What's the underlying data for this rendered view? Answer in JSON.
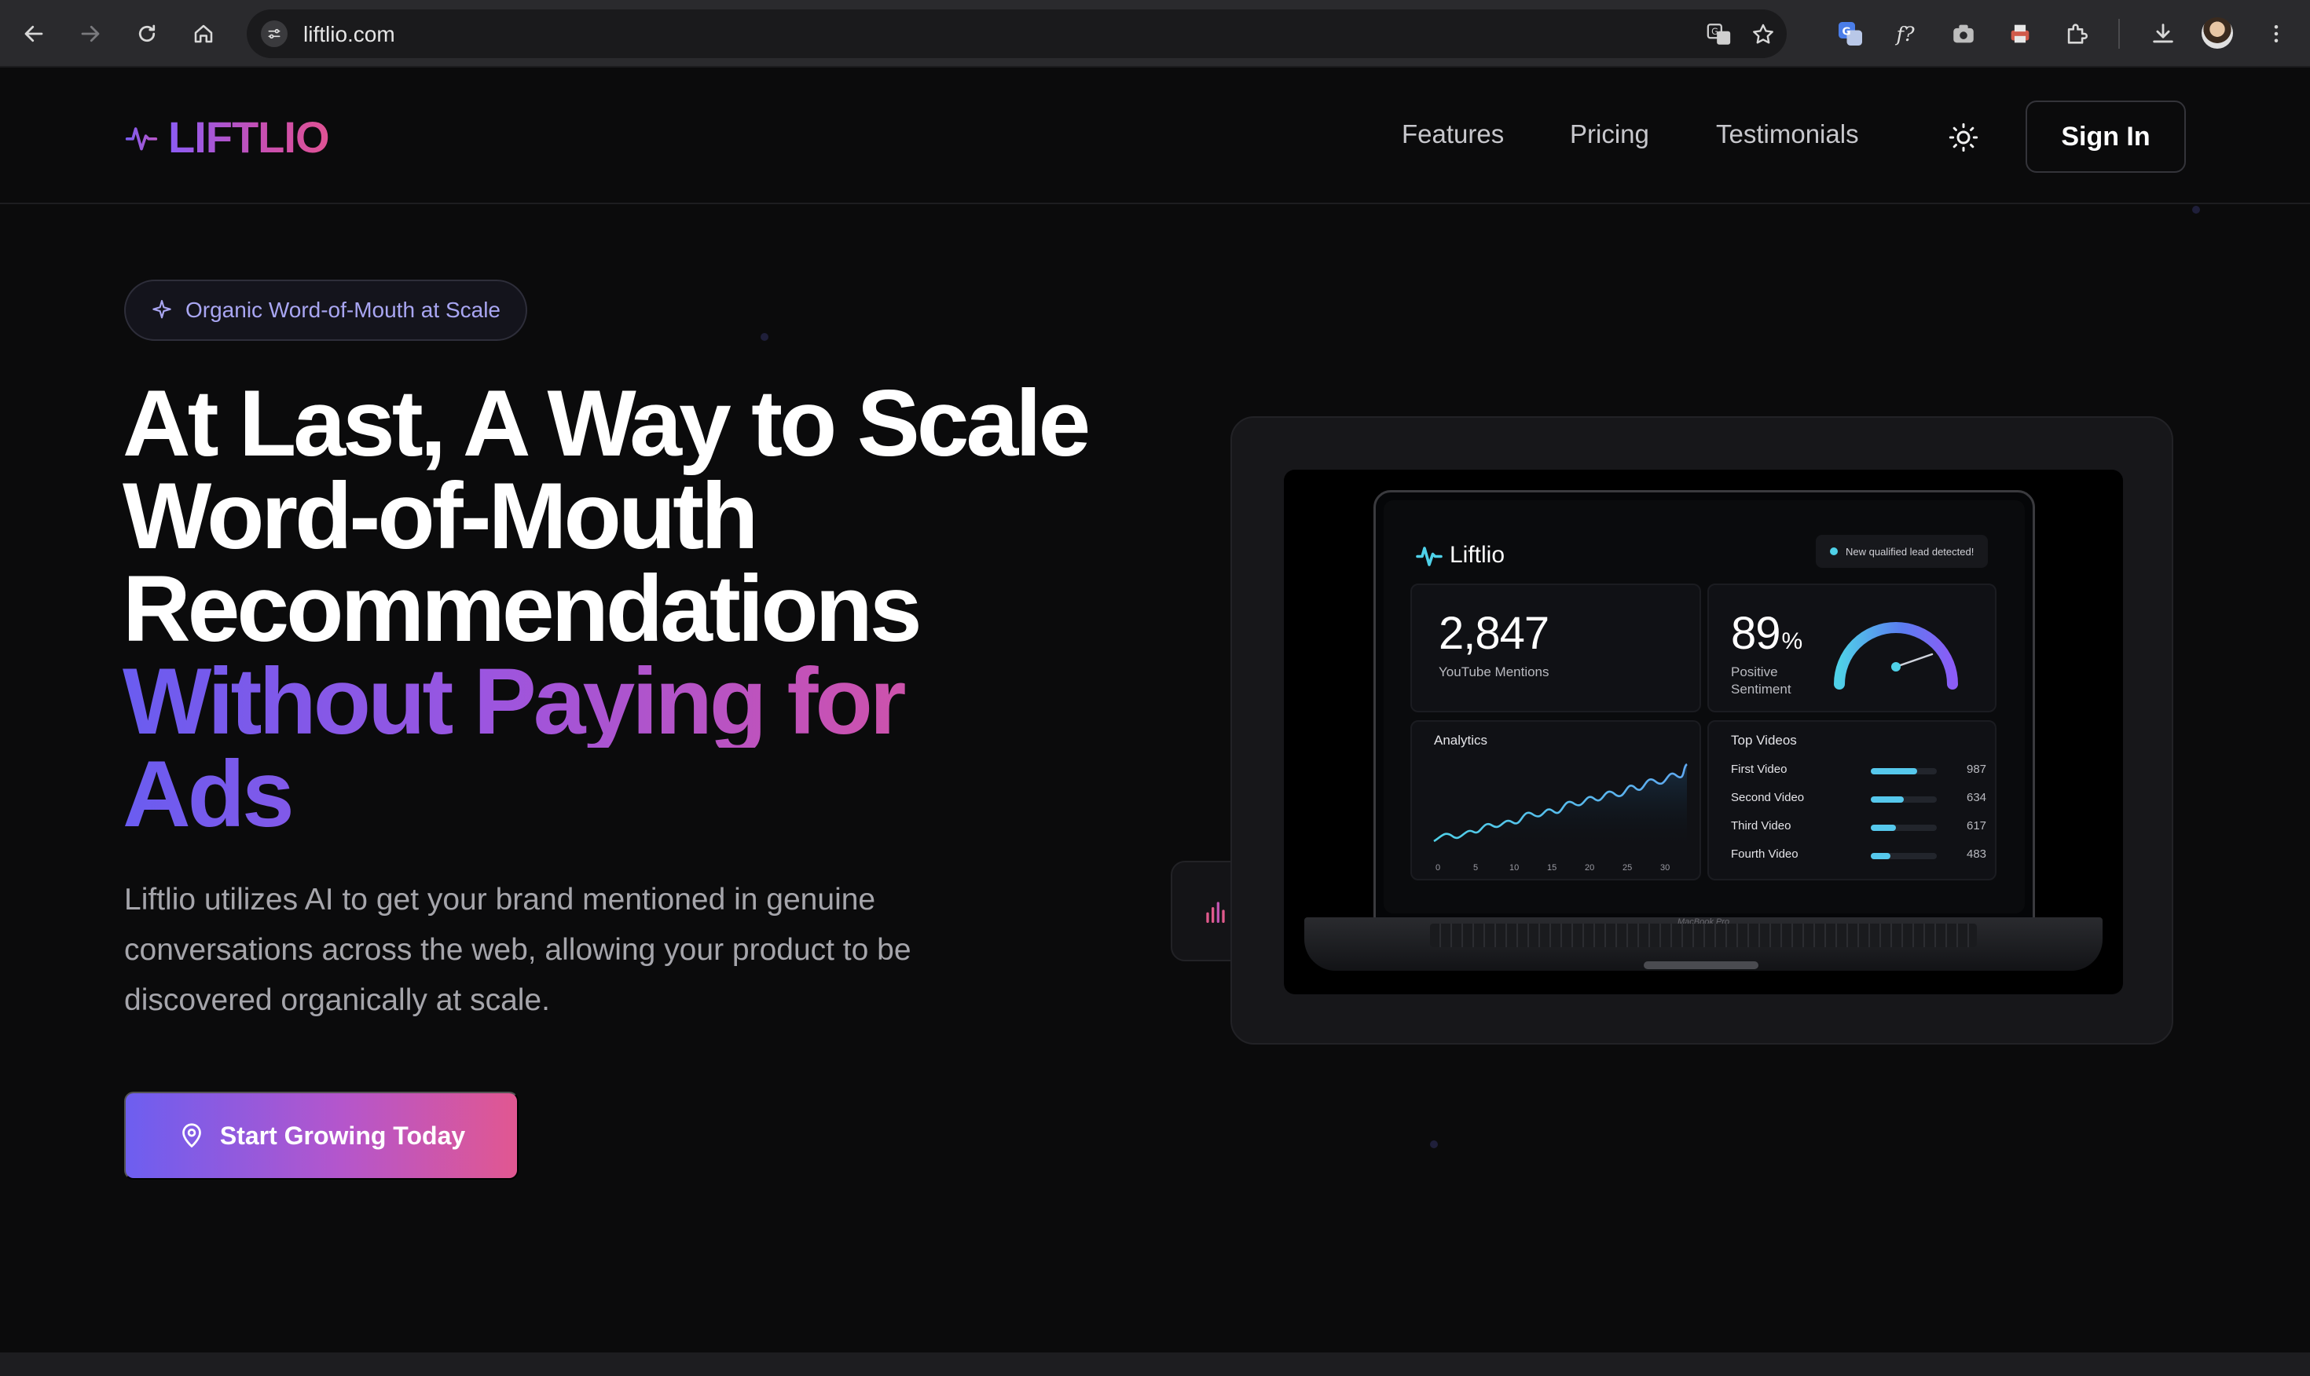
{
  "browser": {
    "url": "liftlio.com",
    "icons": [
      "back-icon",
      "forward-icon",
      "reload-icon",
      "home-icon",
      "site-info-icon",
      "translate-icon",
      "bookmark-star-icon",
      "extension-translate-icon",
      "extension-font-icon",
      "extension-camera-icon",
      "extension-printer-icon",
      "extensions-puzzle-icon",
      "download-icon",
      "profile-avatar",
      "menu-kebab-icon"
    ]
  },
  "header": {
    "logo_text": "LIFTLIO",
    "nav": [
      "Features",
      "Pricing",
      "Testimonials"
    ],
    "theme_icon": "sun-icon",
    "sign_in": "Sign In"
  },
  "hero": {
    "badge": "Organic Word-of-Mouth at Scale",
    "headline_lines": [
      "At Last, A Way to Scale",
      "Word-of-Mouth",
      "Recommendations"
    ],
    "headline_gradient_lines": [
      "Without Paying for",
      "Ads"
    ],
    "subtext": "Liftlio utilizes AI to get your brand mentioned in genuine conversations across the web, allowing your product to be discovered organically at scale.",
    "cta": "Start Growing Today",
    "colors": {
      "gradient_start": "#6d5ef0",
      "gradient_mid": "#b456cc",
      "gradient_end": "#e15791",
      "background": "#0b0b0c"
    }
  },
  "dashboard": {
    "logo": "Liftlio",
    "notification": "New qualified lead detected!",
    "mentions": {
      "value": "2,847",
      "label": "YouTube Mentions"
    },
    "sentiment": {
      "value": "89",
      "unit": "%",
      "label_line1": "Positive",
      "label_line2": "Sentiment",
      "gauge_fraction": 0.89
    },
    "analytics": {
      "title": "Analytics",
      "x_ticks": [
        "0",
        "5",
        "10",
        "15",
        "20",
        "25",
        "30"
      ]
    },
    "top_videos": {
      "title": "Top Videos",
      "items": [
        {
          "name": "First Video",
          "value": "987",
          "fraction": 0.7
        },
        {
          "name": "Second Video",
          "value": "634",
          "fraction": 0.5
        },
        {
          "name": "Third Video",
          "value": "617",
          "fraction": 0.38
        },
        {
          "name": "Fourth Video",
          "value": "483",
          "fraction": 0.3
        }
      ]
    },
    "laptop_label": "MacBook Pro"
  }
}
